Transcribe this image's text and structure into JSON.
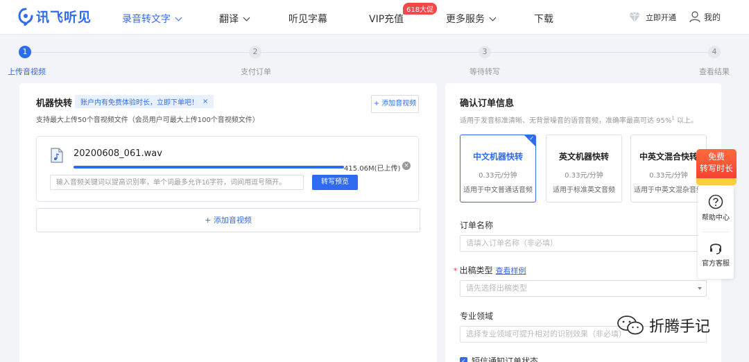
{
  "header": {
    "logo_text": "讯飞听见",
    "nav": [
      {
        "label": "录音转文字",
        "active": true,
        "dropdown": true
      },
      {
        "label": "翻译",
        "dropdown": true
      },
      {
        "label": "听见字幕"
      },
      {
        "label": "VIP充值",
        "badge": "618大促"
      },
      {
        "label": "更多服务",
        "dropdown": true
      },
      {
        "label": "下载"
      }
    ],
    "vip_open": "立即开通",
    "me": "我的"
  },
  "steps": [
    {
      "num": "1",
      "label": "上传音视频",
      "active": true
    },
    {
      "num": "2",
      "label": "支付订单"
    },
    {
      "num": "3",
      "label": "等待转写"
    },
    {
      "num": "4",
      "label": "查看结果"
    }
  ],
  "upload": {
    "title": "机器快转",
    "tip": "账户内有免费体验时长，立即下单吧！",
    "tip_close": "×",
    "add_small": "+ 添加音视频",
    "subtitle": "支持最大上传50个音视频文件（会员用户可最大上传100个音视频文件）",
    "file": {
      "name": "20200608_061.wav",
      "progress": 1.0,
      "size": "415.06M(已上传)",
      "keyword_placeholder": "输入音频关键词以提高识别率，单个词最多允许16字符，词间用逗号隔开。",
      "preview_btn": "转写预览"
    },
    "add_big": "+ 添加音视频"
  },
  "order": {
    "title": "确认订单信息",
    "subtitle_main": "适用于发音标准清晰、无背景噪音的语音音频，准确率最高可达 95%",
    "subtitle_sup": "1",
    "subtitle_tail": " 以上。",
    "plans": [
      {
        "name": "中文机器快转",
        "price": "0.33元/分钟",
        "desc": "适用于中文普通话音频",
        "selected": true
      },
      {
        "name": "英文机器快转",
        "price": "0.33元/分钟",
        "desc": "适用于标准英文音频"
      },
      {
        "name": "中英文混合快转",
        "price": "0.33元/分钟",
        "desc": "适用于中英文混杂音频"
      }
    ],
    "order_name_label": "订单名称",
    "order_name_placeholder": "请填入订单名称（非必填）",
    "req_mark": "*",
    "draft_type_label": "出稿类型",
    "sample_link": "查看样例",
    "draft_type_placeholder": "请先选择出稿类型",
    "domain_label": "专业领域",
    "domain_placeholder": "选择专业领域可提升相对的识别效果（非必填）",
    "sms_label": "短信通知订单状态",
    "sms_check": "✓"
  },
  "side": {
    "promo_line1": "免费",
    "promo_line2": "转写时长",
    "help": "帮助中心",
    "service": "官方客服"
  },
  "watermark": "折腾手记",
  "colors": {
    "accent": "#2f6bf0",
    "badge": "#f2484a",
    "promo": "#f33a2d"
  }
}
